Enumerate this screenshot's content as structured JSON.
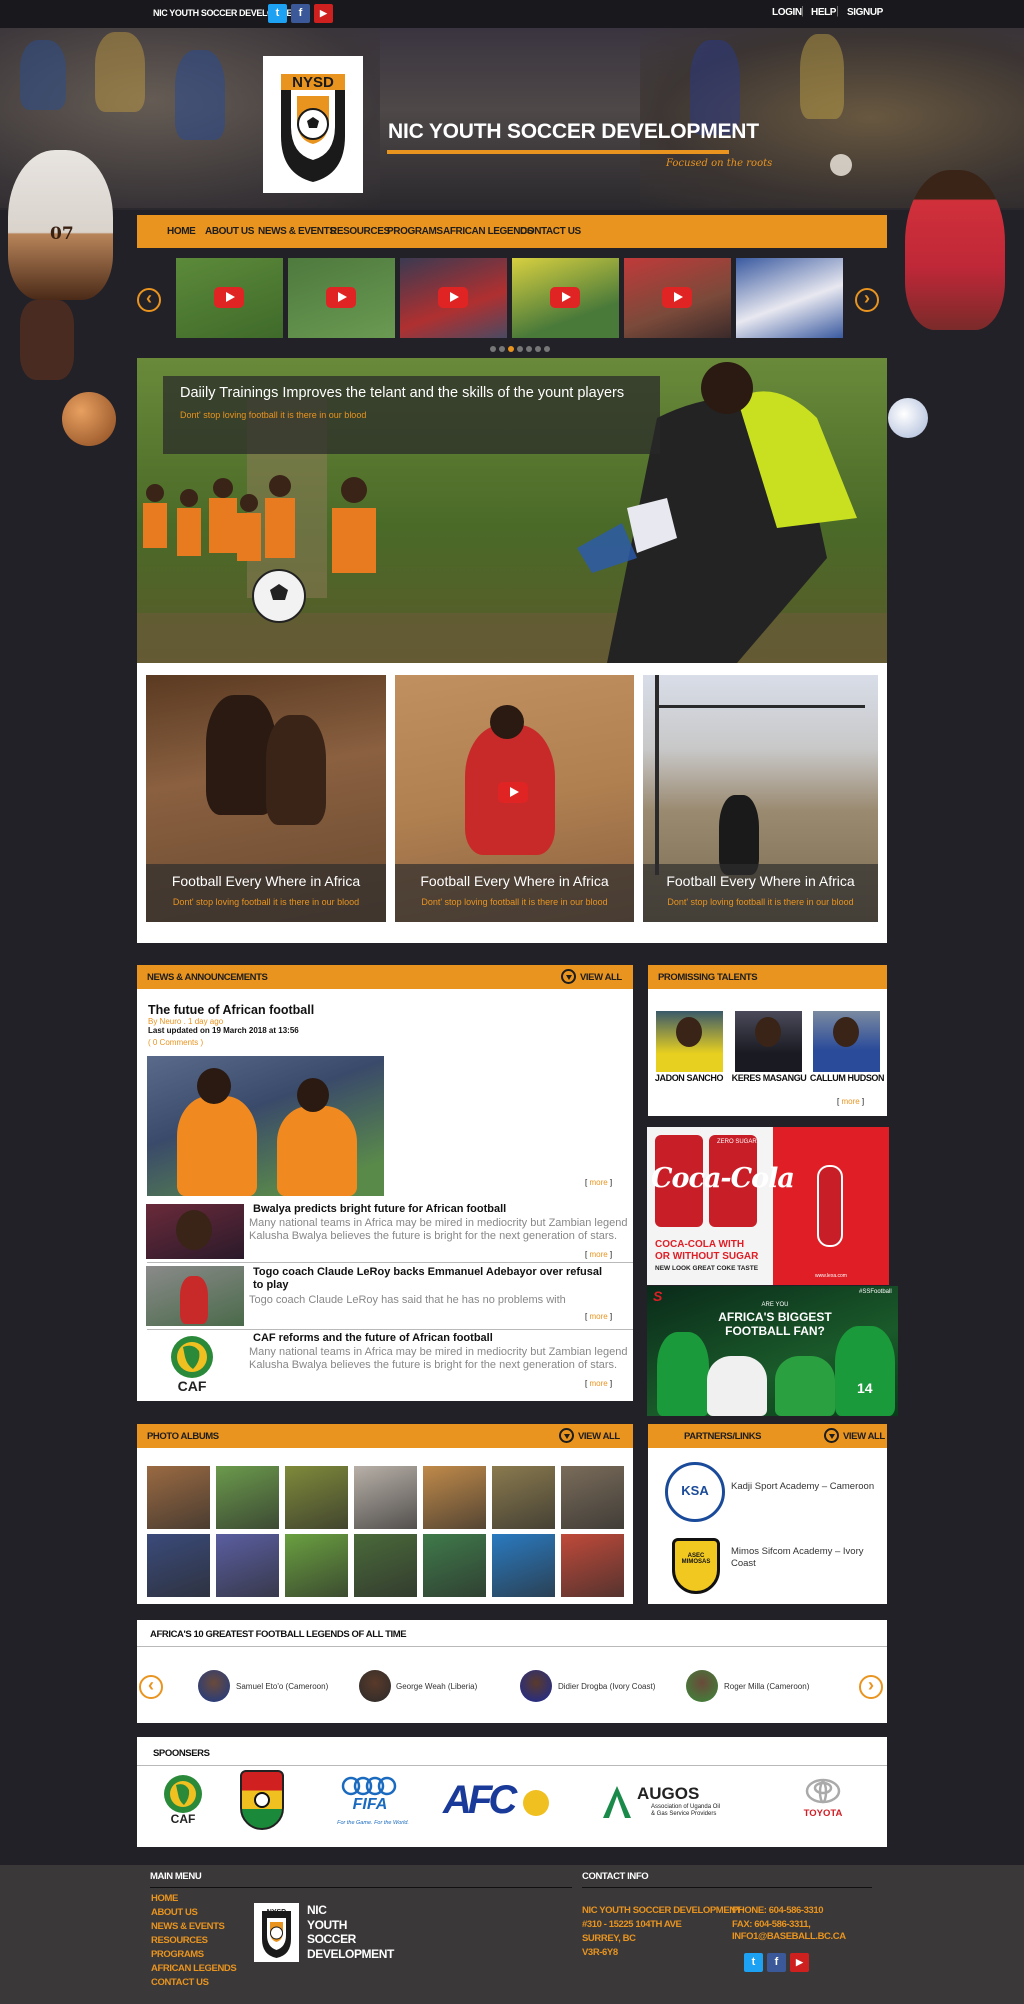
{
  "topbar": {
    "site_name": "NIC YOUTH SOCCER DEVELOPMENT",
    "login": "LOGIN",
    "help": "HELP",
    "signup": "SIGNUP",
    "separator": "|"
  },
  "header": {
    "logo_text": "NYSD",
    "title": "NIC YOUTH SOCCER DEVELOPMENT",
    "tagline": "Focused on the roots",
    "shirt_number": "07"
  },
  "nav": {
    "items": [
      "HOME",
      "ABOUT US",
      "NEWS & EVENTS",
      "RESOURCES",
      "PROGRAMS",
      "AFRICAN LEGENDS",
      "CONTACT US"
    ]
  },
  "carousel": {
    "prev": "‹",
    "next": "›",
    "active_dot": 2,
    "dot_count": 7
  },
  "slider": {
    "title": "Daiily Trainings Improves the telant and the skills of the yount players",
    "subtitle": "Dont' stop loving football it is there in our blood"
  },
  "cards": [
    {
      "title": "Football Every Where in Africa",
      "subtitle": "Dont' stop loving football it is there in our blood"
    },
    {
      "title": "Football Every Where in Africa",
      "subtitle": "Dont' stop loving football it is there in our blood"
    },
    {
      "title": "Football Every Where in Africa",
      "subtitle": "Dont' stop loving football it is there in our blood"
    }
  ],
  "news": {
    "heading": "NEWS & ANNOUNCEMENTS",
    "view_all": "VIEW ALL",
    "featured": {
      "title": "The futue of African football",
      "byline": "By Neuro . 1 day ago",
      "updated": "Last updated on 19 March 2018 at 13:56",
      "comments": "( 0 Comments )",
      "more": "more"
    },
    "items": [
      {
        "title": "Bwalya predicts bright future for African football",
        "desc": "Many national teams in Africa may be mired in mediocrity but Zambian legend Kalusha Bwalya believes the future is bright for the next generation of stars.",
        "more": "more"
      },
      {
        "title": "Togo coach Claude LeRoy backs Emmanuel Adebayor over refusal to play",
        "desc": "Togo coach Claude LeRoy has said that he has no problems with",
        "more": "more"
      },
      {
        "title": "CAF reforms and the future of African football",
        "desc": "Many national teams in Africa may be mired in mediocrity but Zambian legend Kalusha Bwalya believes the future is bright for the next generation of stars.",
        "more": "more"
      }
    ],
    "caf_logo_text": "CAF"
  },
  "talents": {
    "heading": "PROMISSING TALENTS",
    "players": [
      "JADON SANCHO",
      "KERES MASANGU",
      "CALLUM HUDSON"
    ],
    "more": "more"
  },
  "ads": {
    "coke_brand": "Coca-Cola",
    "coke_line1": "COCA-COLA WITH",
    "coke_line2": "OR WITHOUT SUGAR",
    "coke_line3": "NEW LOOK GREAT COKE TASTE",
    "coke_zero": "ZERO SUGAR",
    "coke_site": "www.lexa.com",
    "ss_hashtag": "#SSFootball",
    "ss_line1": "ARE YOU",
    "ss_line2": "AFRICA'S BIGGEST",
    "ss_line3": "FOOTBALL FAN?",
    "ss_jersey": "14"
  },
  "photos": {
    "heading": "PHOTO ALBUMS",
    "view_all": "VIEW ALL",
    "colors": [
      "#9a6a42",
      "#6b9a4c",
      "#7f8a3a",
      "#b8b0a8",
      "#c08a4a",
      "#8a7a4e",
      "#7a6c5a",
      "#3a4a7a",
      "#5a5ea0",
      "#6aa040",
      "#4a6a3a",
      "#3f7a4a",
      "#2a7ac0",
      "#c04a3a"
    ]
  },
  "partners": {
    "heading": "PARTNERS/LINKS",
    "view_all": "VIEW ALL",
    "items": [
      {
        "name": "Kadji Sport Academy – Cameroon",
        "logo": "KSA"
      },
      {
        "name": "Mimos Sifcom Academy – Ivory Coast",
        "logo": "ASEC MIMOSAS"
      }
    ]
  },
  "legends": {
    "heading": "AFRICA'S 10 GREATEST FOOTBALL LEGENDS OF ALL TIME",
    "prev": "‹",
    "next": "›",
    "items": [
      "Samuel Eto'o (Cameroon)",
      "George Weah (Liberia)",
      "Didier Drogba (Ivory Coast)",
      "Roger Milla (Cameroon)"
    ]
  },
  "sponsors": {
    "heading": "SPOONSERS",
    "caf": "CAF",
    "fifa": "FIFA",
    "fifa_tag": "For the Game. For the World.",
    "afc": "AFC",
    "augos": "AUGOS",
    "augos_sub1": "Association of Uganda Oil",
    "augos_sub2": "& Gas Service Providers",
    "toyota": "TOYOTA"
  },
  "footer": {
    "menu_heading": "MAIN MENU",
    "menu": [
      "HOME",
      "ABOUT US",
      "NEWS & EVENTS",
      "RESOURCES",
      "PROGRAMS",
      "AFRICAN LEGENDS",
      "CONTACT US"
    ],
    "logo_text": "NYSD",
    "org_lines": [
      "NIC",
      "YOUTH",
      "SOCCER",
      "DEVELOPMENT"
    ],
    "contact_heading": "CONTACT INFO",
    "address": [
      "NIC YOUTH SOCCER DEVELOPMENT",
      "#310 - 15225 104TH AVE",
      "SURREY, BC",
      "V3R-6Y8"
    ],
    "contacts": [
      "PHONE: 604-586-3310",
      "FAX: 604-586-3311,",
      "INFO1@BASEBALL.BC.CA"
    ]
  },
  "social_icons": {
    "twitter": "t",
    "facebook": "f",
    "youtube": "▶"
  },
  "colors": {
    "accent": "#e9941f",
    "background": "#232128",
    "footer": "#3a3839"
  }
}
